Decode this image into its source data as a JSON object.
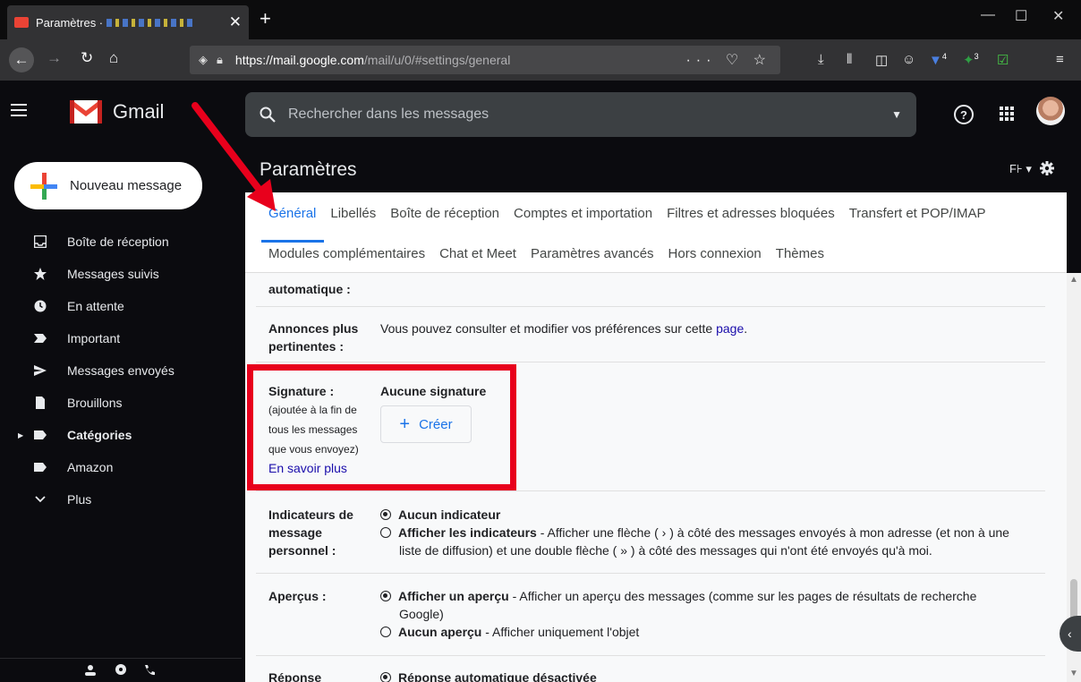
{
  "browser": {
    "tab_title": "Paramètres ·",
    "url_host": "https://mail.google.com",
    "url_path": "/mail/u/0/#settings/general",
    "url_actions": "··· ♡ ☆",
    "window_controls": [
      "—",
      "☐",
      "✕"
    ],
    "badge_counts": [
      "4",
      "3"
    ]
  },
  "gmail": {
    "brand": "Gmail",
    "search_placeholder": "Rechercher dans les messages"
  },
  "compose": {
    "label": "Nouveau message"
  },
  "sidebar": {
    "items": [
      {
        "label": "Boîte de réception",
        "icon": "inbox-icon"
      },
      {
        "label": "Messages suivis",
        "icon": "star-icon"
      },
      {
        "label": "En attente",
        "icon": "clock-icon"
      },
      {
        "label": "Important",
        "icon": "important-icon"
      },
      {
        "label": "Messages envoyés",
        "icon": "send-icon"
      },
      {
        "label": "Brouillons",
        "icon": "draft-icon"
      },
      {
        "label": "Catégories",
        "icon": "label-icon"
      },
      {
        "label": "Amazon",
        "icon": "label-icon"
      },
      {
        "label": "Plus",
        "icon": "chevron-down-icon"
      }
    ]
  },
  "settings": {
    "title": "Paramètres",
    "lang": "F⊦ ▾",
    "tabs_row1": [
      "Général",
      "Libellés",
      "Boîte de réception",
      "Comptes et importation",
      "Filtres et adresses bloquées",
      "Transfert et POP/IMAP"
    ],
    "tabs_row2": [
      "Modules complémentaires",
      "Chat et Meet",
      "Paramètres avancés",
      "Hors connexion",
      "Thèmes"
    ],
    "auto_label": "automatique :",
    "ads_label_1": "Annonces plus",
    "ads_label_2": "pertinentes :",
    "ads_text": "Vous pouvez consulter et modifier vos préférences sur cette",
    "ads_link": "page",
    "ads_end": ".",
    "sig_label": "Signature :",
    "sig_note": [
      "(ajoutée à la fin de",
      "tous les messages",
      "que vous envoyez)"
    ],
    "sig_learn": "En savoir plus",
    "sig_none": "Aucune signature",
    "sig_create": "Créer",
    "ind_label": [
      "Indicateurs de",
      "message",
      "personnel :"
    ],
    "ind_opt1": "Aucun indicateur",
    "ind_opt2_b": "Afficher les indicateurs",
    "ind_opt2_t": " - Afficher une flèche ( › ) à côté des messages envoyés à mon adresse (et non à une",
    "ind_opt2_t2": "liste de diffusion) et une double flèche ( » ) à côté des messages qui n'ont été envoyés qu'à moi.",
    "prev_label": "Aperçus :",
    "prev_opt1_b": "Afficher un aperçu",
    "prev_opt1_t": " - Afficher un aperçu des messages (comme sur les pages de résultats de recherche",
    "prev_opt1_t2": "Google)",
    "prev_opt2_b": "Aucun aperçu",
    "prev_opt2_t": " - Afficher uniquement l'objet",
    "reply_label": "Réponse",
    "reply_opt": "Réponse automatique désactivée"
  },
  "colors": {
    "highlight": "#e8001c",
    "accent": "#1a73e8"
  }
}
